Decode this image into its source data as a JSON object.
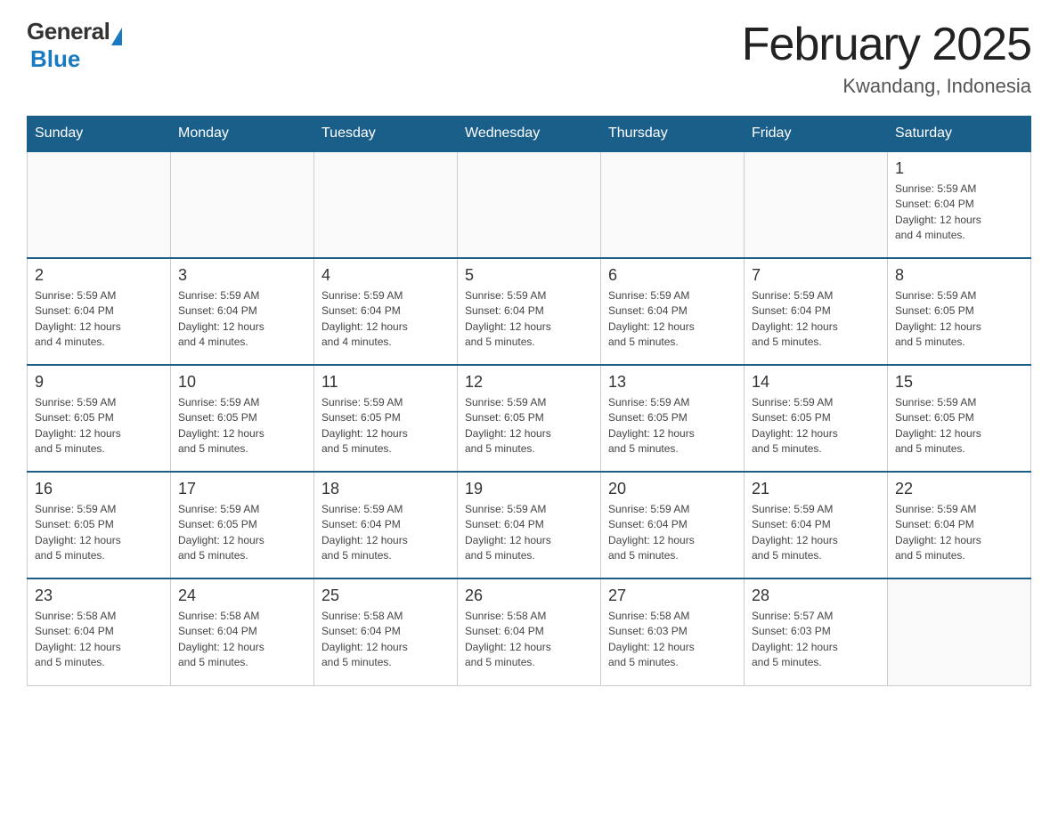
{
  "logo": {
    "general": "General",
    "blue": "Blue"
  },
  "title": "February 2025",
  "subtitle": "Kwandang, Indonesia",
  "weekdays": [
    "Sunday",
    "Monday",
    "Tuesday",
    "Wednesday",
    "Thursday",
    "Friday",
    "Saturday"
  ],
  "weeks": [
    [
      {
        "day": "",
        "info": ""
      },
      {
        "day": "",
        "info": ""
      },
      {
        "day": "",
        "info": ""
      },
      {
        "day": "",
        "info": ""
      },
      {
        "day": "",
        "info": ""
      },
      {
        "day": "",
        "info": ""
      },
      {
        "day": "1",
        "info": "Sunrise: 5:59 AM\nSunset: 6:04 PM\nDaylight: 12 hours\nand 4 minutes."
      }
    ],
    [
      {
        "day": "2",
        "info": "Sunrise: 5:59 AM\nSunset: 6:04 PM\nDaylight: 12 hours\nand 4 minutes."
      },
      {
        "day": "3",
        "info": "Sunrise: 5:59 AM\nSunset: 6:04 PM\nDaylight: 12 hours\nand 4 minutes."
      },
      {
        "day": "4",
        "info": "Sunrise: 5:59 AM\nSunset: 6:04 PM\nDaylight: 12 hours\nand 4 minutes."
      },
      {
        "day": "5",
        "info": "Sunrise: 5:59 AM\nSunset: 6:04 PM\nDaylight: 12 hours\nand 5 minutes."
      },
      {
        "day": "6",
        "info": "Sunrise: 5:59 AM\nSunset: 6:04 PM\nDaylight: 12 hours\nand 5 minutes."
      },
      {
        "day": "7",
        "info": "Sunrise: 5:59 AM\nSunset: 6:04 PM\nDaylight: 12 hours\nand 5 minutes."
      },
      {
        "day": "8",
        "info": "Sunrise: 5:59 AM\nSunset: 6:05 PM\nDaylight: 12 hours\nand 5 minutes."
      }
    ],
    [
      {
        "day": "9",
        "info": "Sunrise: 5:59 AM\nSunset: 6:05 PM\nDaylight: 12 hours\nand 5 minutes."
      },
      {
        "day": "10",
        "info": "Sunrise: 5:59 AM\nSunset: 6:05 PM\nDaylight: 12 hours\nand 5 minutes."
      },
      {
        "day": "11",
        "info": "Sunrise: 5:59 AM\nSunset: 6:05 PM\nDaylight: 12 hours\nand 5 minutes."
      },
      {
        "day": "12",
        "info": "Sunrise: 5:59 AM\nSunset: 6:05 PM\nDaylight: 12 hours\nand 5 minutes."
      },
      {
        "day": "13",
        "info": "Sunrise: 5:59 AM\nSunset: 6:05 PM\nDaylight: 12 hours\nand 5 minutes."
      },
      {
        "day": "14",
        "info": "Sunrise: 5:59 AM\nSunset: 6:05 PM\nDaylight: 12 hours\nand 5 minutes."
      },
      {
        "day": "15",
        "info": "Sunrise: 5:59 AM\nSunset: 6:05 PM\nDaylight: 12 hours\nand 5 minutes."
      }
    ],
    [
      {
        "day": "16",
        "info": "Sunrise: 5:59 AM\nSunset: 6:05 PM\nDaylight: 12 hours\nand 5 minutes."
      },
      {
        "day": "17",
        "info": "Sunrise: 5:59 AM\nSunset: 6:05 PM\nDaylight: 12 hours\nand 5 minutes."
      },
      {
        "day": "18",
        "info": "Sunrise: 5:59 AM\nSunset: 6:04 PM\nDaylight: 12 hours\nand 5 minutes."
      },
      {
        "day": "19",
        "info": "Sunrise: 5:59 AM\nSunset: 6:04 PM\nDaylight: 12 hours\nand 5 minutes."
      },
      {
        "day": "20",
        "info": "Sunrise: 5:59 AM\nSunset: 6:04 PM\nDaylight: 12 hours\nand 5 minutes."
      },
      {
        "day": "21",
        "info": "Sunrise: 5:59 AM\nSunset: 6:04 PM\nDaylight: 12 hours\nand 5 minutes."
      },
      {
        "day": "22",
        "info": "Sunrise: 5:59 AM\nSunset: 6:04 PM\nDaylight: 12 hours\nand 5 minutes."
      }
    ],
    [
      {
        "day": "23",
        "info": "Sunrise: 5:58 AM\nSunset: 6:04 PM\nDaylight: 12 hours\nand 5 minutes."
      },
      {
        "day": "24",
        "info": "Sunrise: 5:58 AM\nSunset: 6:04 PM\nDaylight: 12 hours\nand 5 minutes."
      },
      {
        "day": "25",
        "info": "Sunrise: 5:58 AM\nSunset: 6:04 PM\nDaylight: 12 hours\nand 5 minutes."
      },
      {
        "day": "26",
        "info": "Sunrise: 5:58 AM\nSunset: 6:04 PM\nDaylight: 12 hours\nand 5 minutes."
      },
      {
        "day": "27",
        "info": "Sunrise: 5:58 AM\nSunset: 6:03 PM\nDaylight: 12 hours\nand 5 minutes."
      },
      {
        "day": "28",
        "info": "Sunrise: 5:57 AM\nSunset: 6:03 PM\nDaylight: 12 hours\nand 5 minutes."
      },
      {
        "day": "",
        "info": ""
      }
    ]
  ]
}
